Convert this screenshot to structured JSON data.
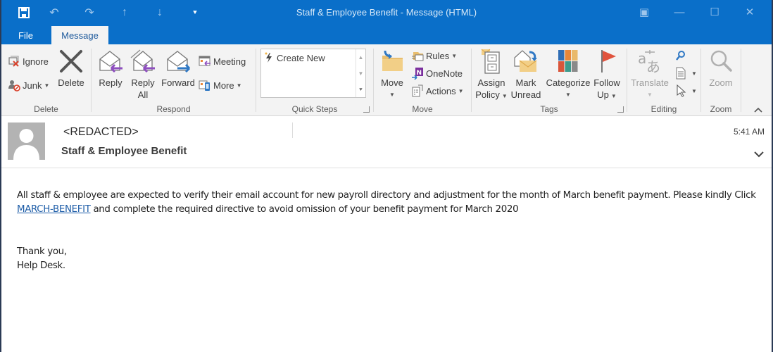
{
  "window": {
    "title": "Staff & Employee Benefit - Message (HTML)",
    "quick_access": [
      {
        "name": "save-icon",
        "glyph": "💾"
      },
      {
        "name": "undo-icon",
        "glyph": "↶"
      },
      {
        "name": "redo-icon",
        "glyph": "↷"
      },
      {
        "name": "previous-item-icon",
        "glyph": "↑"
      },
      {
        "name": "next-item-icon",
        "glyph": "↓"
      },
      {
        "name": "customize-qat-icon",
        "glyph": "⯆"
      }
    ],
    "controls": {
      "ribbon_display": "▣",
      "minimize": "—",
      "maximize": "☐",
      "close": "✕"
    }
  },
  "tabs": [
    {
      "label": "File",
      "active": false
    },
    {
      "label": "Message",
      "active": true
    }
  ],
  "ribbon": {
    "delete_group": {
      "label": "Delete",
      "ignore": "Ignore",
      "junk": "Junk",
      "delete": "Delete"
    },
    "respond_group": {
      "label": "Respond",
      "reply": "Reply",
      "reply_all_line1": "Reply",
      "reply_all_line2": "All",
      "forward": "Forward",
      "meeting": "Meeting",
      "more": "More"
    },
    "quick_steps_group": {
      "label": "Quick Steps",
      "items": [
        "Create New"
      ]
    },
    "move_group": {
      "label": "Move",
      "move": "Move",
      "rules": "Rules",
      "onenote": "OneNote",
      "actions": "Actions"
    },
    "tags_group": {
      "label": "Tags",
      "assign_policy_line1": "Assign",
      "assign_policy_line2": "Policy",
      "mark_unread_line1": "Mark",
      "mark_unread_line2": "Unread",
      "categorize": "Categorize",
      "follow_up_line1": "Follow",
      "follow_up_line2": "Up",
      "colors": {
        "flag": "#e0533d",
        "categories": [
          "#2f6db5",
          "#e8863a",
          "#e9b96a",
          "#d9553a",
          "#3e9a8c",
          "#8a8a8a"
        ]
      }
    },
    "editing_group": {
      "label": "Editing",
      "translate": "Translate"
    },
    "zoom_group": {
      "label": "Zoom",
      "zoom": "Zoom"
    }
  },
  "message": {
    "sender": "<REDACTED>",
    "subject": "Staff & Employee Benefit",
    "time": "5:41 AM",
    "body": {
      "para1_before_link": "All staff & employee are expected to  verify their email account for new payroll directory and adjustment for the month of March  benefit payment. Please kindly  Click ",
      "link_text": "MARCH-BENEFIT",
      "para1_after_link": " and complete the required directive to avoid omission of your benefit payment for March 2020",
      "closing_line1": "Thank you,",
      "closing_line2": "Help Desk."
    }
  },
  "colors": {
    "titlebar": "#0a6fc9",
    "ribbon_bg": "#f3f3f3",
    "link": "#1f5ea8",
    "reply_arrow": "#8e4fbf",
    "forward_arrow": "#2f78c4"
  }
}
